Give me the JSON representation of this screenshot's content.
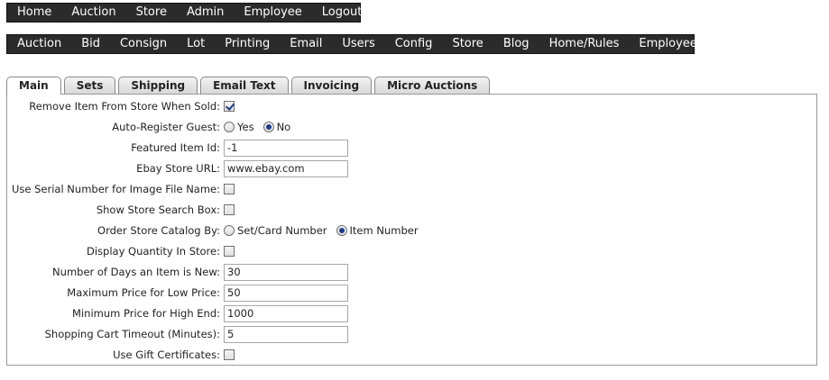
{
  "top_nav": [
    "Home",
    "Auction",
    "Store",
    "Admin",
    "Employee",
    "Logout"
  ],
  "sub_nav": [
    "Auction",
    "Bid",
    "Consign",
    "Lot",
    "Printing",
    "Email",
    "Users",
    "Config",
    "Store",
    "Blog",
    "Home/Rules",
    "Employees"
  ],
  "tabs": [
    "Main",
    "Sets",
    "Shipping",
    "Email Text",
    "Invoicing",
    "Micro Auctions"
  ],
  "form": {
    "remove_item": {
      "label": "Remove Item From Store When Sold:",
      "checked": true
    },
    "auto_register": {
      "label": "Auto-Register Guest:",
      "opt_yes": "Yes",
      "opt_no": "No",
      "selected": "No"
    },
    "featured_item": {
      "label": "Featured Item Id:",
      "value": "-1"
    },
    "ebay_url": {
      "label": "Ebay Store URL:",
      "value": "www.ebay.com"
    },
    "serial_image": {
      "label": "Use Serial Number for Image File Name:",
      "checked": false
    },
    "store_search": {
      "label": "Show Store Search Box:",
      "checked": false
    },
    "order_catalog": {
      "label": "Order Store Catalog By:",
      "opt_set": "Set/Card Number",
      "opt_item": "Item Number",
      "selected": "Item Number"
    },
    "display_qty": {
      "label": "Display Quantity In Store:",
      "checked": false
    },
    "days_new": {
      "label": "Number of Days an Item is New:",
      "value": "30"
    },
    "max_low_price": {
      "label": "Maximum Price for Low Price:",
      "value": "50"
    },
    "min_high_end": {
      "label": "Minimum Price for High End:",
      "value": "1000"
    },
    "cart_timeout": {
      "label": "Shopping Cart Timeout (Minutes):",
      "value": "5"
    },
    "gift_certs": {
      "label": "Use Gift Certificates:",
      "checked": false
    }
  },
  "colors": {
    "nav_bg": "#2b2b2b",
    "nav_text": "#ffffff",
    "radio_dot": "#1f3b86"
  }
}
